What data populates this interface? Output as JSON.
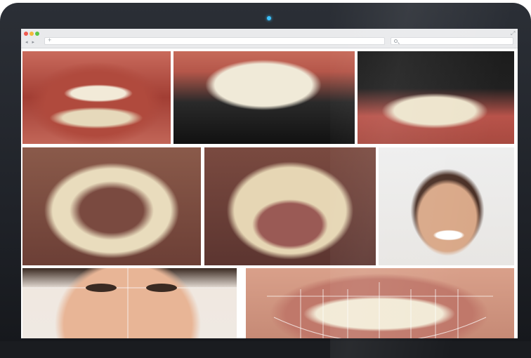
{
  "browser": {
    "url_value": "",
    "search_value": ""
  },
  "gallery": {
    "photos": [
      {
        "id": "frontal-teeth-closeup",
        "caption": ""
      },
      {
        "id": "upper-incisors-black-background",
        "caption": ""
      },
      {
        "id": "lower-teeth-dark-background",
        "caption": ""
      },
      {
        "id": "upper-arch-occlusal",
        "caption": ""
      },
      {
        "id": "lower-arch-occlusal",
        "caption": ""
      },
      {
        "id": "patient-smile-portrait",
        "caption": ""
      },
      {
        "id": "face-guideline-analysis",
        "caption": ""
      },
      {
        "id": "smile-design-overlay",
        "caption": ""
      }
    ]
  },
  "icons": {
    "camera": "camera-dot",
    "search": "search-icon",
    "expand": "expand-icon",
    "nav": "nav-arrows-icon"
  },
  "colors": {
    "screen_camera": "#3cc3ff",
    "traffic_red": "#ef5a50",
    "traffic_yellow": "#f3b83a",
    "traffic_green": "#5cc646"
  }
}
